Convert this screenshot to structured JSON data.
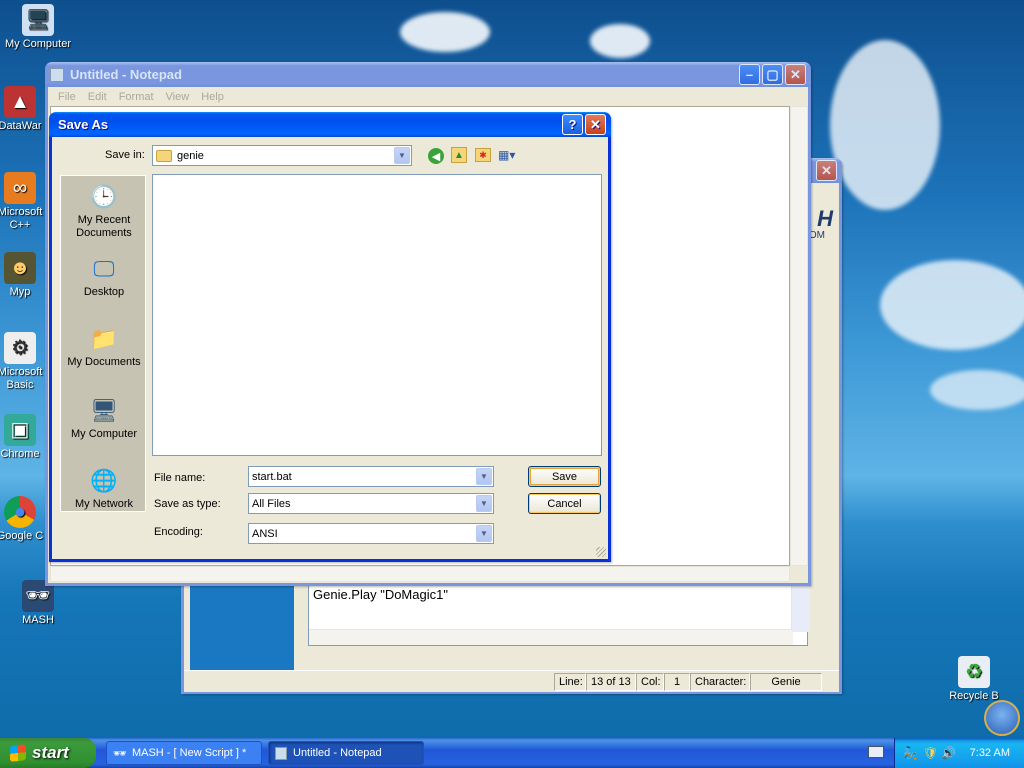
{
  "desktop": {
    "icons": [
      {
        "label": "My Computer",
        "icon": "computer-icon"
      },
      {
        "label": "DataWar",
        "icon": "program-icon"
      },
      {
        "label": "Microsoft C++",
        "icon": "program-icon"
      },
      {
        "label": "Myp",
        "icon": "program-icon"
      },
      {
        "label": "Microsoft Basic",
        "icon": "program-icon"
      },
      {
        "label": "Chrome",
        "icon": "program-icon"
      },
      {
        "label": "Google C",
        "icon": "chrome-icon"
      },
      {
        "label": "MASH",
        "icon": "program-icon"
      },
      {
        "label": "Recycle B",
        "icon": "recycle-bin-icon"
      }
    ]
  },
  "notepad": {
    "title": "Untitled - Notepad",
    "menu": [
      "File",
      "Edit",
      "Format",
      "View",
      "Help"
    ]
  },
  "mash": {
    "header_fragment": "H",
    "header_fragment2": "OM",
    "script_text": "Genie.Play \"DoMagic1\"",
    "status": {
      "line_label": "Line:",
      "line_value": "13 of 13",
      "col_label": "Col:",
      "col_value": "1",
      "char_label": "Character:",
      "char_value": "Genie"
    }
  },
  "saveas": {
    "title": "Save As",
    "save_in_label": "Save in:",
    "save_in_value": "genie",
    "places": [
      "My Recent Documents",
      "Desktop",
      "My Documents",
      "My Computer",
      "My Network"
    ],
    "file_name_label": "File name:",
    "file_name_value": "start.bat",
    "save_type_label": "Save as type:",
    "save_type_value": "All Files",
    "encoding_label": "Encoding:",
    "encoding_value": "ANSI",
    "save_button": "Save",
    "cancel_button": "Cancel",
    "help_button": "?",
    "close_button": "✕"
  },
  "taskbar": {
    "start_label": "start",
    "items": [
      {
        "label": "MASH - [ New Script ] *"
      },
      {
        "label": "Untitled - Notepad"
      }
    ],
    "clock": "7:32 AM"
  }
}
